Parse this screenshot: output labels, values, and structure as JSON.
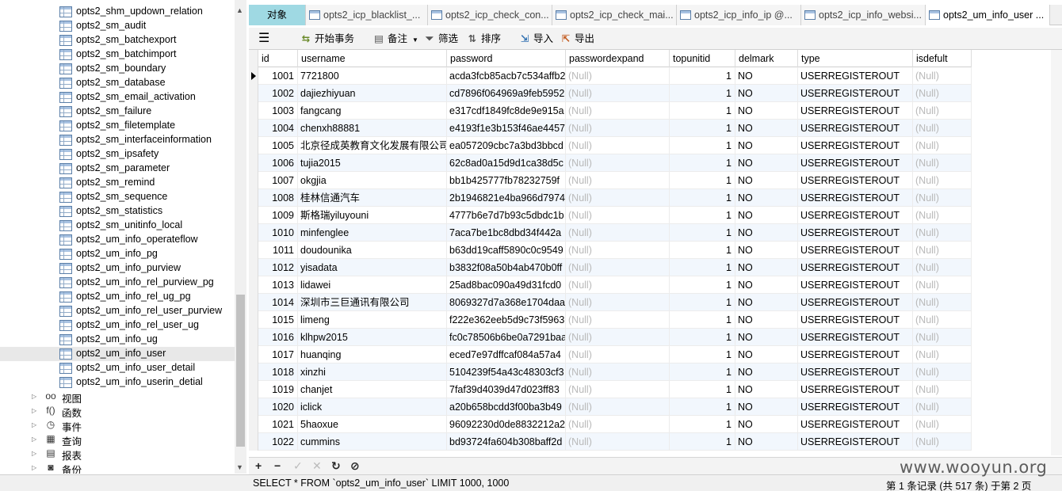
{
  "sidebar": {
    "tables": [
      "opts2_shm_updown_relation",
      "opts2_sm_audit",
      "opts2_sm_batchexport",
      "opts2_sm_batchimport",
      "opts2_sm_boundary",
      "opts2_sm_database",
      "opts2_sm_email_activation",
      "opts2_sm_failure",
      "opts2_sm_filetemplate",
      "opts2_sm_interfaceinformation",
      "opts2_sm_ipsafety",
      "opts2_sm_parameter",
      "opts2_sm_remind",
      "opts2_sm_sequence",
      "opts2_sm_statistics",
      "opts2_sm_unitinfo_local",
      "opts2_um_info_operateflow",
      "opts2_um_info_pg",
      "opts2_um_info_purview",
      "opts2_um_info_rel_purview_pg",
      "opts2_um_info_rel_ug_pg",
      "opts2_um_info_rel_user_purview",
      "opts2_um_info_rel_user_ug",
      "opts2_um_info_ug",
      "opts2_um_info_user",
      "opts2_um_info_user_detail",
      "opts2_um_info_userin_detial"
    ],
    "selected_index": 24,
    "groups": [
      {
        "label": "视图",
        "icon": "views-icon",
        "glyph": "oo"
      },
      {
        "label": "函数",
        "icon": "function-icon",
        "glyph": "f()"
      },
      {
        "label": "事件",
        "icon": "event-icon",
        "glyph": "◷"
      },
      {
        "label": "查询",
        "icon": "query-icon",
        "glyph": "▦"
      },
      {
        "label": "报表",
        "icon": "report-icon",
        "glyph": "▤"
      },
      {
        "label": "备份",
        "icon": "backup-icon",
        "glyph": "◙"
      }
    ]
  },
  "tabs": [
    {
      "label": "对象",
      "kind": "objects"
    },
    {
      "label": "opts2_icp_blacklist_..."
    },
    {
      "label": "opts2_icp_check_con..."
    },
    {
      "label": "opts2_icp_check_mai..."
    },
    {
      "label": "opts2_icp_info_ip @..."
    },
    {
      "label": "opts2_icp_info_websi..."
    },
    {
      "label": "opts2_um_info_user ...",
      "kind": "active"
    }
  ],
  "toolbar": {
    "menu_icon": "hamburger-icon",
    "begin_transaction": "开始事务",
    "notes": "备注",
    "filter": "筛选",
    "sort": "排序",
    "import": "导入",
    "export": "导出"
  },
  "grid": {
    "columns": [
      "id",
      "username",
      "password",
      "passwordexpand",
      "topunitid",
      "delmark",
      "type",
      "isdefult"
    ],
    "rows": [
      [
        "1001",
        "7721800",
        "acda3fcb85acb7c534affb2",
        "(Null)",
        "1",
        "NO",
        "USERREGISTEROUT",
        "(Null)"
      ],
      [
        "1002",
        "dajiezhiyuan",
        "cd7896f064969a9feb5952",
        "(Null)",
        "1",
        "NO",
        "USERREGISTEROUT",
        "(Null)"
      ],
      [
        "1003",
        "fangcang",
        "e317cdf1849fc8de9e915a",
        "(Null)",
        "1",
        "NO",
        "USERREGISTEROUT",
        "(Null)"
      ],
      [
        "1004",
        "chenxh88881",
        "e4193f1e3b153f46ae4457",
        "(Null)",
        "1",
        "NO",
        "USERREGISTEROUT",
        "(Null)"
      ],
      [
        "1005",
        "北京径成英教育文化发展有限公司",
        "ea057209cbc7a3bd3bbcd",
        "(Null)",
        "1",
        "NO",
        "USERREGISTEROUT",
        "(Null)"
      ],
      [
        "1006",
        "tujia2015",
        "62c8ad0a15d9d1ca38d5c",
        "(Null)",
        "1",
        "NO",
        "USERREGISTEROUT",
        "(Null)"
      ],
      [
        "1007",
        "okgjia",
        "bb1b425777fb78232759f",
        "(Null)",
        "1",
        "NO",
        "USERREGISTEROUT",
        "(Null)"
      ],
      [
        "1008",
        "桂林信通汽车",
        "2b1946821e4ba966d7974",
        "(Null)",
        "1",
        "NO",
        "USERREGISTEROUT",
        "(Null)"
      ],
      [
        "1009",
        "斯格瑞yiluyouni",
        "4777b6e7d7b93c5dbdc1b",
        "(Null)",
        "1",
        "NO",
        "USERREGISTEROUT",
        "(Null)"
      ],
      [
        "1010",
        "minfenglee",
        "7aca7be1bc8dbd34f442a",
        "(Null)",
        "1",
        "NO",
        "USERREGISTEROUT",
        "(Null)"
      ],
      [
        "1011",
        "doudounika",
        "b63dd19caff5890c0c9549",
        "(Null)",
        "1",
        "NO",
        "USERREGISTEROUT",
        "(Null)"
      ],
      [
        "1012",
        "yisadata",
        "b3832f08a50b4ab470b0ff",
        "(Null)",
        "1",
        "NO",
        "USERREGISTEROUT",
        "(Null)"
      ],
      [
        "1013",
        "lidawei",
        "25ad8bac090a49d31fcd0",
        "(Null)",
        "1",
        "NO",
        "USERREGISTEROUT",
        "(Null)"
      ],
      [
        "1014",
        "深圳市三巨通讯有限公司",
        "8069327d7a368e1704daa",
        "(Null)",
        "1",
        "NO",
        "USERREGISTEROUT",
        "(Null)"
      ],
      [
        "1015",
        "limeng",
        "f222e362eeb5d9c73f5963",
        "(Null)",
        "1",
        "NO",
        "USERREGISTEROUT",
        "(Null)"
      ],
      [
        "1016",
        "klhpw2015",
        "fc0c78506b6be0a7291baa",
        "(Null)",
        "1",
        "NO",
        "USERREGISTEROUT",
        "(Null)"
      ],
      [
        "1017",
        "huanqing",
        "eced7e97dffcaf084a57a4",
        "(Null)",
        "1",
        "NO",
        "USERREGISTEROUT",
        "(Null)"
      ],
      [
        "1018",
        "xinzhi",
        "5104239f54a43c48303cf3",
        "(Null)",
        "1",
        "NO",
        "USERREGISTEROUT",
        "(Null)"
      ],
      [
        "1019",
        "chanjet",
        "7faf39d4039d47d023ff83",
        "(Null)",
        "1",
        "NO",
        "USERREGISTEROUT",
        "(Null)"
      ],
      [
        "1020",
        "iclick",
        "a20b658bcdd3f00ba3b49",
        "(Null)",
        "1",
        "NO",
        "USERREGISTEROUT",
        "(Null)"
      ],
      [
        "1021",
        "5haoxue",
        "96092230d0de8832212a2",
        "(Null)",
        "1",
        "NO",
        "USERREGISTEROUT",
        "(Null)"
      ],
      [
        "1022",
        "cummins",
        "bd93724fa604b308baff2d",
        "(Null)",
        "1",
        "NO",
        "USERREGISTEROUT",
        "(Null)"
      ]
    ],
    "current_row": 0
  },
  "bottombar": [
    "+",
    "−",
    "✓",
    "✕",
    "↻",
    "⊘"
  ],
  "status": {
    "sql": "SELECT * FROM `opts2_um_info_user` LIMIT 1000, 1000",
    "records": "第 1 条记录 (共 517 条) 于第 2 页"
  },
  "watermark": "www.wooyun.org"
}
